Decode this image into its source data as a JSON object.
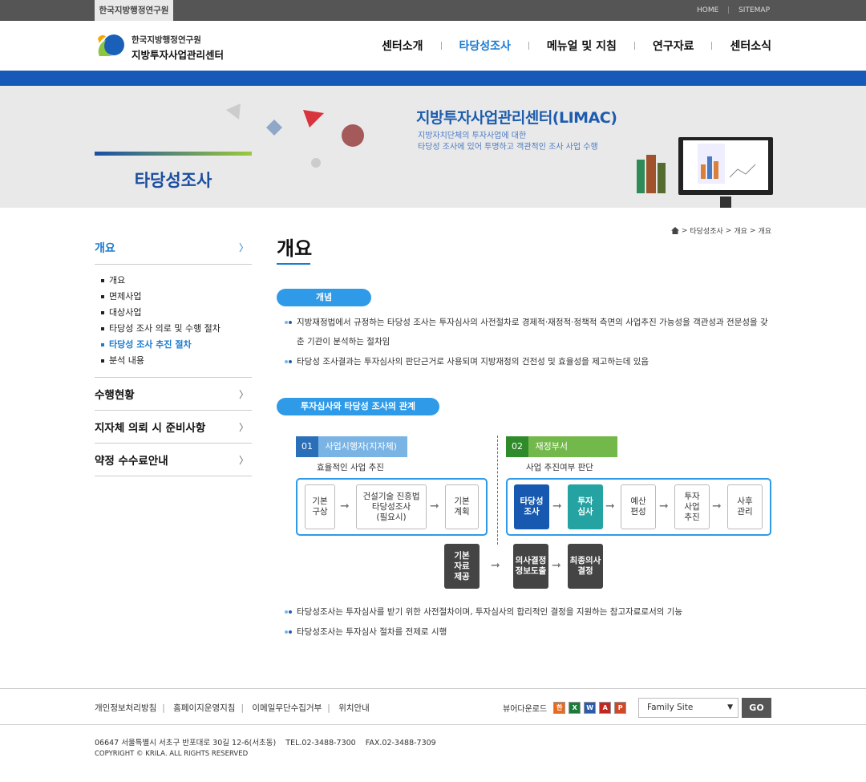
{
  "topbar": {
    "org": "한국지방행정연구원",
    "links": [
      "HOME",
      "SITEMAP"
    ]
  },
  "logo": {
    "line1": "한국지방행정연구원",
    "line2": "지방투자사업관리센터"
  },
  "gnb": [
    "센터소개",
    "타당성조사",
    "메뉴얼 및 지침",
    "연구자료",
    "센터소식"
  ],
  "visual": {
    "section_title": "타당성조사",
    "heading": "지방투자사업관리센터(LIMAC)",
    "desc1": "지방자치단체의 투자사업에 대한",
    "desc2": "타당성 조사에 있어 투명하고 객관적인 조사 사업 수행"
  },
  "lnb": {
    "head": "개요",
    "items": [
      "개요",
      "면제사업",
      "대상사업",
      "타당성 조사 의로 및 수행 절차",
      "타당성 조사 추진 절차",
      "분석 내용"
    ],
    "groups": [
      "수행현황",
      "지자체 의뢰 시 준비사항",
      "약정 수수료안내"
    ]
  },
  "breadcrumb": [
    "타당성조사",
    "개요",
    "개요"
  ],
  "page_title": "개요",
  "sec1": {
    "label": "개념",
    "b1a": "지방재정법에서 규정하는 타당성 조사는 투자심사의 사전절차로 경제적·재정적·정책적 측면의 사업추진 가능성을 객관성과 전문성을 갖",
    "b1b": "춘 기관이 분석하는 절차임",
    "b2": "타당성 조사결과는 투자심사의 판단근거로 사용되며 지방재정의 건전성 및 효율성을 제고하는데 있음"
  },
  "sec2": {
    "label": "투자심사와 타당성 조사의 관계",
    "left": {
      "num": "01",
      "title": "사업시행자(지자체)",
      "sub": "효율적인 사업 추진"
    },
    "right": {
      "num": "02",
      "title": "재정부서",
      "sub": "사업 추진여부 판단"
    },
    "b1": "타당성조사는 투자심사를 받기 위한 사전절차이며, 투자심사의 합리적인 결정을 지원하는 참고자료로서의 기능",
    "b2": "타당성조사는 투자심사 절차를 전제로 시행"
  },
  "footer": {
    "links": [
      "개인정보처리방침",
      "홈페이지운영지침",
      "이메일무단수집거부",
      "위치안내"
    ],
    "viewer": "뷰어다운로드",
    "family": "Family Site",
    "go": "GO",
    "address": "06647 서울특별시 서초구 반포대로 30길 12-6(서초동)    TEL.02-3488-7300    FAX.02-3488-7309",
    "copyright": "COPYRIGHT © KRILA. ALL RIGHTS RESERVED"
  }
}
